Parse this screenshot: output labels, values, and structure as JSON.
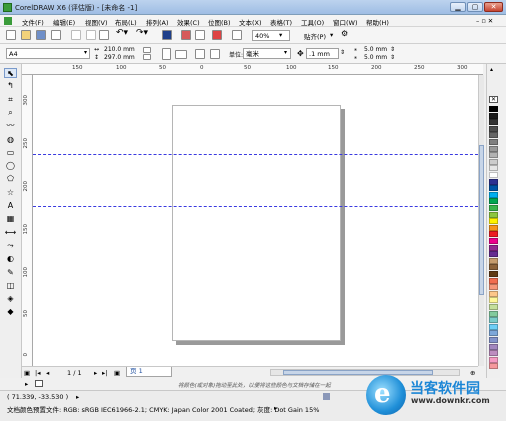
{
  "titlebar": {
    "title": "CorelDRAW X6 (评估版) - [未命名 -1]"
  },
  "menu": [
    "文件(F)",
    "编辑(E)",
    "视图(V)",
    "布局(L)",
    "排列(A)",
    "效果(C)",
    "位图(B)",
    "文本(X)",
    "表格(T)",
    "工具(O)",
    "窗口(W)",
    "帮助(H)"
  ],
  "std_toolbar": {
    "zoom": "40%",
    "snap_label": "贴齐(P)"
  },
  "property_bar": {
    "paper_size": "A4",
    "width": "210.0 mm",
    "height": "297.0 mm",
    "units_label": "单位:",
    "units_value": "毫米",
    "nudge": ".1 mm",
    "dup_x": "5.0 mm",
    "dup_y": "5.0 mm"
  },
  "ruler": {
    "h_labels": [
      "150",
      "100",
      "50",
      "0",
      "50",
      "100",
      "150",
      "200",
      "250",
      "300"
    ],
    "v_labels": [
      "300",
      "250",
      "200",
      "150",
      "100",
      "50",
      "0"
    ]
  },
  "page_nav": {
    "counter": "1 / 1",
    "page_tab": "页 1"
  },
  "status": {
    "drag_hint": "将颜色(或对象)拖动至此处，以便将这些颜色与文档存储在一起",
    "coords": "( 71.339, -33.530 )",
    "color_profile": "文档颜色预置文件: RGB: sRGB IEC61966-2.1; CMYK: Japan Color 2001 Coated; 灰度: Dot Gain 15%"
  },
  "watermark": {
    "name": "当客软件园",
    "url": "www.downkr.com"
  },
  "colors": {
    "palette": [
      "#000000",
      "#1a1a1a",
      "#333333",
      "#4d4d4d",
      "#666666",
      "#808080",
      "#999999",
      "#b3b3b3",
      "#cccccc",
      "#e6e6e6",
      "#ffffff",
      "#2e3192",
      "#0054a6",
      "#00aeef",
      "#00a651",
      "#39b54a",
      "#8dc63f",
      "#fff200",
      "#f7941d",
      "#ed1c24",
      "#ec008c",
      "#92278f",
      "#662d91",
      "#c69c6d",
      "#8c6239",
      "#603913",
      "#f26c4f",
      "#f69679",
      "#fdc689",
      "#fff799",
      "#c4df9b",
      "#82ca9c",
      "#7accc8",
      "#6dcff6",
      "#7da7d9",
      "#8393ca",
      "#a186be",
      "#bd8cbf",
      "#f49ac2",
      "#f5989d"
    ],
    "guide": "#3a3ae0",
    "brand": "#1b86d6"
  }
}
